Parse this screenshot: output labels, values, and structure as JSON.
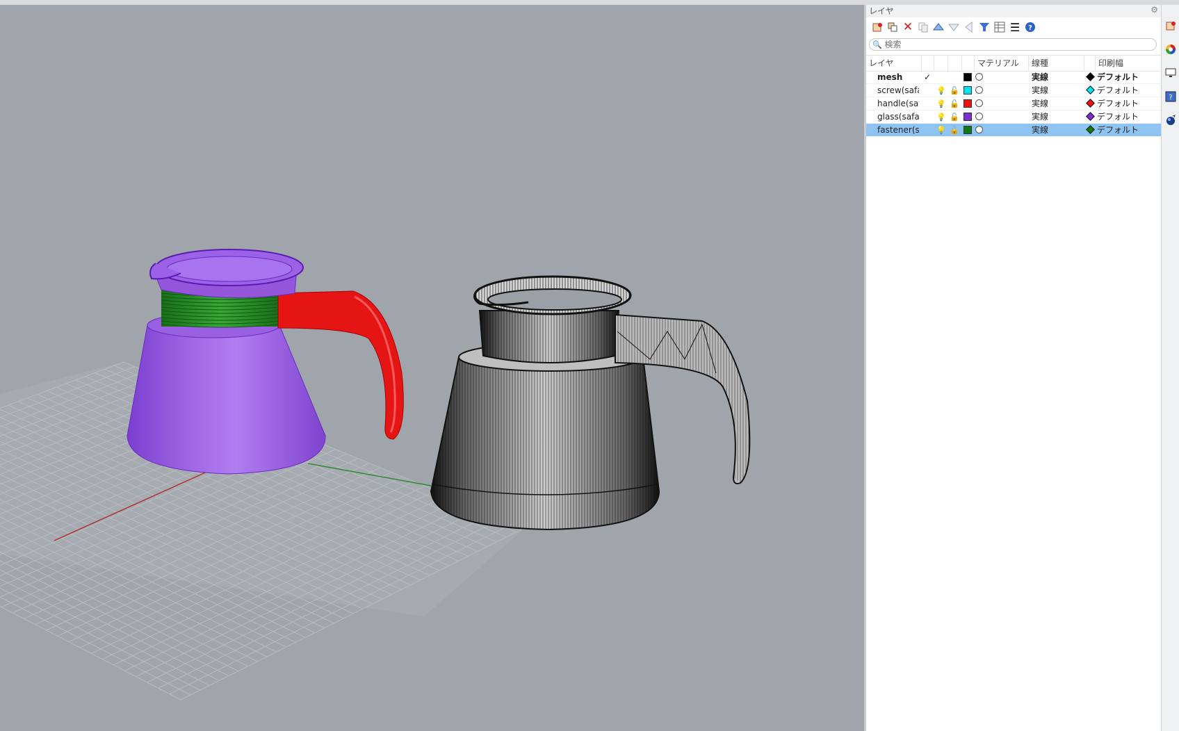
{
  "viewport": {
    "objects": [
      {
        "name": "colored-teapot",
        "colors": {
          "glass": "#9a5ee0",
          "fastener": "#1e8a1e",
          "handle": "#e41414"
        }
      },
      {
        "name": "mesh-teapot",
        "colors": {
          "wire": "#111111",
          "fill": "#d0d0d0"
        }
      }
    ],
    "background": "#9fa5ab",
    "grid_color": "#b1b5ba"
  },
  "panel": {
    "title": "レイヤ",
    "search_placeholder": "検索",
    "toolbar": [
      {
        "icon": "new-layer-icon"
      },
      {
        "icon": "new-sublayer-icon"
      },
      {
        "icon": "delete-icon"
      },
      {
        "icon": "copy-icon"
      },
      {
        "icon": "move-up-icon"
      },
      {
        "icon": "move-down-icon"
      },
      {
        "icon": "move-left-icon"
      },
      {
        "icon": "filter-icon"
      },
      {
        "icon": "table-icon"
      },
      {
        "icon": "menu-icon"
      },
      {
        "icon": "help-icon"
      }
    ],
    "columns": {
      "layer": "レイヤ",
      "material": "マテリアル",
      "linetype": "線種",
      "printwidth": "印刷幅"
    },
    "rows": [
      {
        "name": "mesh",
        "current": true,
        "color": "#000000",
        "linetype": "実線",
        "print_color": "#000000",
        "print": "デフォルト",
        "bold": true,
        "selected": false
      },
      {
        "name": "screw(safac",
        "current": false,
        "color": "#00e5f0",
        "linetype": "実線",
        "print_color": "#00e5f0",
        "print": "デフォルト",
        "bold": false,
        "selected": false
      },
      {
        "name": "handle(safa",
        "current": false,
        "color": "#ee1111",
        "linetype": "実線",
        "print_color": "#ee1111",
        "print": "デフォルト",
        "bold": false,
        "selected": false
      },
      {
        "name": "glass(safac",
        "current": false,
        "color": "#7a2ed6",
        "linetype": "実線",
        "print_color": "#7a2ed6",
        "print": "デフォルト",
        "bold": false,
        "selected": false
      },
      {
        "name": "fastener(sa",
        "current": false,
        "color": "#137a13",
        "linetype": "実線",
        "print_color": "#137a13",
        "print": "デフォルト",
        "bold": false,
        "selected": true
      }
    ]
  },
  "sidebar": [
    {
      "icon": "layers-icon"
    },
    {
      "icon": "color-wheel-icon"
    },
    {
      "icon": "display-icon"
    },
    {
      "icon": "help-panel-icon"
    },
    {
      "icon": "render-icon"
    }
  ]
}
